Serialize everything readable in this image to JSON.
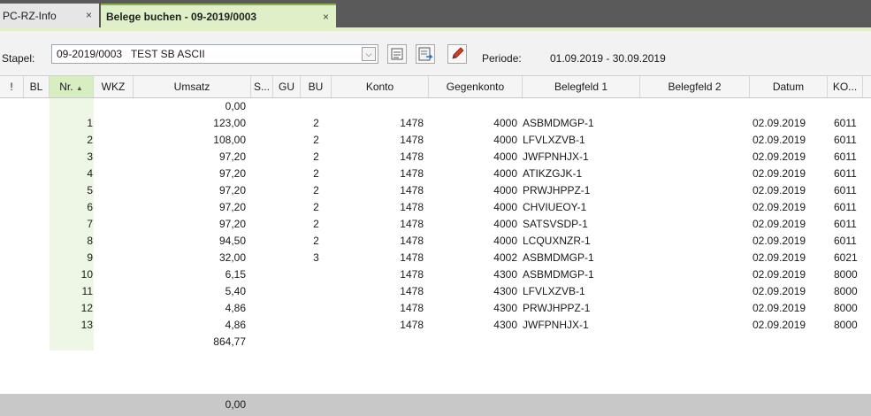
{
  "tabs": [
    {
      "label": "PC-RZ-Info",
      "close": "×"
    },
    {
      "label": "Belege buchen  - 09-2019/0003",
      "close": "×"
    }
  ],
  "toolbar": {
    "stapel_label": "Stapel:",
    "stapel_value": "09-2019/0003   TEST SB ASCII",
    "dropdown_glyph": "⌵",
    "periode_label": "Periode:",
    "periode_value": "01.09.2019 - 30.09.2019"
  },
  "columns": [
    "!",
    "BL",
    "Nr.",
    "WKZ",
    "Umsatz",
    "S...",
    "GU",
    "BU",
    "Konto",
    "Gegenkonto",
    "Belegfeld 1",
    "Belegfeld 2",
    "Datum",
    "KO...",
    ""
  ],
  "sort_glyph": "▲",
  "rows": [
    {
      "nr": "",
      "umsatz": "0,00",
      "bu": "",
      "konto": "",
      "gegenkonto": "",
      "belegfeld1": "",
      "datum": "",
      "ko": ""
    },
    {
      "nr": "1",
      "umsatz": "123,00",
      "bu": "2",
      "konto": "1478",
      "gegenkonto": "4000",
      "belegfeld1": "ASBMDMGP-1",
      "datum": "02.09.2019",
      "ko": "6011"
    },
    {
      "nr": "2",
      "umsatz": "108,00",
      "bu": "2",
      "konto": "1478",
      "gegenkonto": "4000",
      "belegfeld1": "LFVLXZVB-1",
      "datum": "02.09.2019",
      "ko": "6011"
    },
    {
      "nr": "3",
      "umsatz": "97,20",
      "bu": "2",
      "konto": "1478",
      "gegenkonto": "4000",
      "belegfeld1": "JWFPNHJX-1",
      "datum": "02.09.2019",
      "ko": "6011"
    },
    {
      "nr": "4",
      "umsatz": "97,20",
      "bu": "2",
      "konto": "1478",
      "gegenkonto": "4000",
      "belegfeld1": "ATIKZGJK-1",
      "datum": "02.09.2019",
      "ko": "6011"
    },
    {
      "nr": "5",
      "umsatz": "97,20",
      "bu": "2",
      "konto": "1478",
      "gegenkonto": "4000",
      "belegfeld1": "PRWJHPPZ-1",
      "datum": "02.09.2019",
      "ko": "6011"
    },
    {
      "nr": "6",
      "umsatz": "97,20",
      "bu": "2",
      "konto": "1478",
      "gegenkonto": "4000",
      "belegfeld1": "CHVIUEOY-1",
      "datum": "02.09.2019",
      "ko": "6011"
    },
    {
      "nr": "7",
      "umsatz": "97,20",
      "bu": "2",
      "konto": "1478",
      "gegenkonto": "4000",
      "belegfeld1": "SATSVSDP-1",
      "datum": "02.09.2019",
      "ko": "6011"
    },
    {
      "nr": "8",
      "umsatz": "94,50",
      "bu": "2",
      "konto": "1478",
      "gegenkonto": "4000",
      "belegfeld1": "LCQUXNZR-1",
      "datum": "02.09.2019",
      "ko": "6011"
    },
    {
      "nr": "9",
      "umsatz": "32,00",
      "bu": "3",
      "konto": "1478",
      "gegenkonto": "4002",
      "belegfeld1": "ASBMDMGP-1",
      "datum": "02.09.2019",
      "ko": "6021"
    },
    {
      "nr": "10",
      "umsatz": "6,15",
      "bu": "",
      "konto": "1478",
      "gegenkonto": "4300",
      "belegfeld1": "ASBMDMGP-1",
      "datum": "02.09.2019",
      "ko": "8000"
    },
    {
      "nr": "11",
      "umsatz": "5,40",
      "bu": "",
      "konto": "1478",
      "gegenkonto": "4300",
      "belegfeld1": "LFVLXZVB-1",
      "datum": "02.09.2019",
      "ko": "8000"
    },
    {
      "nr": "12",
      "umsatz": "4,86",
      "bu": "",
      "konto": "1478",
      "gegenkonto": "4300",
      "belegfeld1": "PRWJHPPZ-1",
      "datum": "02.09.2019",
      "ko": "8000"
    },
    {
      "nr": "13",
      "umsatz": "4,86",
      "bu": "",
      "konto": "1478",
      "gegenkonto": "4300",
      "belegfeld1": "JWFPNHJX-1",
      "datum": "02.09.2019",
      "ko": "8000"
    },
    {
      "nr": "",
      "umsatz": "864,77",
      "bu": "",
      "konto": "",
      "gegenkonto": "",
      "belegfeld1": "",
      "datum": "",
      "ko": ""
    }
  ],
  "footer": {
    "total": "0,00"
  }
}
